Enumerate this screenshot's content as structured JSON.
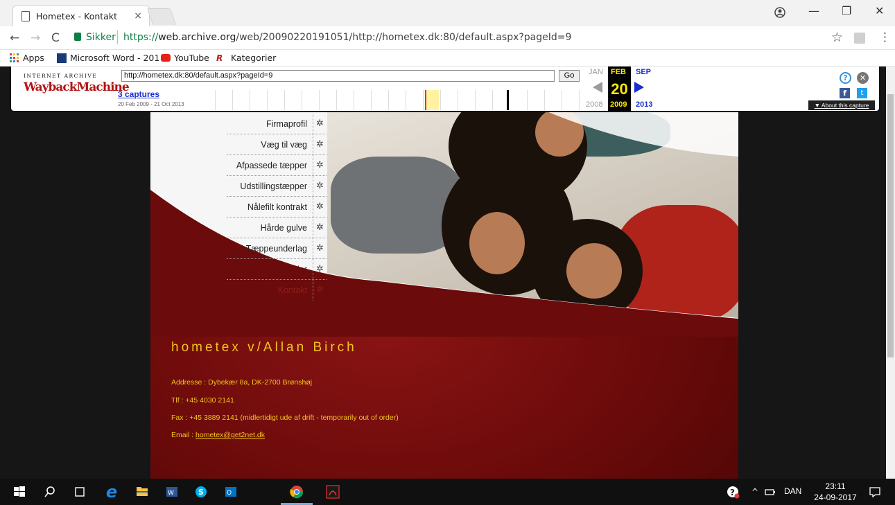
{
  "browser": {
    "tab_title": "Hometex - Kontakt",
    "tab_close": "×",
    "back": "←",
    "forward": "→",
    "reload": "C",
    "secure_label": "Sikker",
    "url_proto": "https://",
    "url_host": "web.archive.org",
    "url_path": "/web/20090220191051/http://hometex.dk:80/default.aspx?pageId=9",
    "star": "☆",
    "menu": "⋮",
    "minimize": "—",
    "restore": "❐",
    "close": "✕"
  },
  "bookmarks": [
    {
      "label": "Apps",
      "icon": "apps-grid-icon",
      "color": "#e53935"
    },
    {
      "label": "Microsoft Word - 201",
      "icon": "word-icon",
      "color": "#1a3a78"
    },
    {
      "label": "YouTube",
      "icon": "youtube-icon",
      "color": "#e62117"
    },
    {
      "label": "Kategorier",
      "icon": "kategorier-icon",
      "color": "#b71c1c"
    }
  ],
  "wayback": {
    "logo_top": "INTERNET ARCHIVE",
    "logo_main": "WaybackMachine",
    "url": "http://hometex.dk:80/default.aspx?pageId=9",
    "go": "Go",
    "captures": "3 captures",
    "range": "20 Feb 2009 - 21 Oct 2013",
    "prev_month": "JAN",
    "cur_month": "FEB",
    "next_month": "SEP",
    "day": "20",
    "prev_year": "2008",
    "cur_year": "2009",
    "next_year": "2013",
    "help": "?",
    "close": "✕",
    "fb": "f",
    "tw": "t",
    "about": "▼ About this capture"
  },
  "site": {
    "menu": [
      "Firmaprofil",
      "Væg til væg",
      "Afpassede tæpper",
      "Udstillingstæpper",
      "Nålefilt kontrakt",
      "Hårde gulve",
      "Tæppeunderlag",
      "Nyheder",
      "Kontakt"
    ],
    "gear": "✲",
    "company": "hometex v/Allan Birch",
    "address": "Addresse : Dybekær 8a, DK-2700 Brønshøj",
    "phone": "Tlf :   +45 4030 2141",
    "fax": "Fax : +45 3889 2141 (midlertidigt ude af drift - temporarily out of order)",
    "email_label": "Email : ",
    "email": "hometex@get2net.dk"
  },
  "taskbar": {
    "lang": "DAN",
    "time": "23:11",
    "date": "24-09-2017"
  }
}
